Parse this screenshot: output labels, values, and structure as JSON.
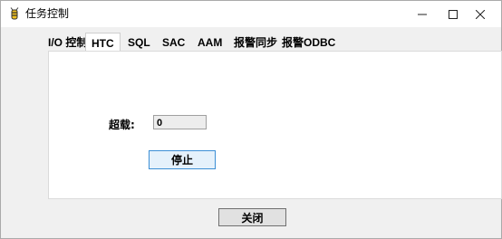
{
  "window": {
    "title": "任务控制",
    "icon": "bee-app-icon",
    "controls": {
      "minimize": "—",
      "maximize": "☐",
      "close": "✕"
    }
  },
  "tabs": [
    {
      "label": "I/O 控制",
      "active": false
    },
    {
      "label": "HTC",
      "active": true
    },
    {
      "label": "SQL",
      "active": false
    },
    {
      "label": "SAC",
      "active": false
    },
    {
      "label": "AAM",
      "active": false
    },
    {
      "label": "报警同步",
      "active": false
    },
    {
      "label": "报警ODBC",
      "active": false
    }
  ],
  "panel": {
    "overload_label": "超载:",
    "overload_value": "0",
    "stop_button": "停止"
  },
  "footer": {
    "close_button": "关闭"
  }
}
